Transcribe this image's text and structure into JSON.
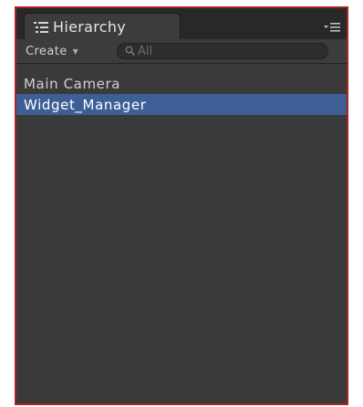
{
  "panel": {
    "title": "Hierarchy",
    "title_icon": "list-icon",
    "menu_icon": "panel-menu-icon"
  },
  "toolbar": {
    "create_label": "Create",
    "create_caret": "▼",
    "search_placeholder": "All",
    "search_value": ""
  },
  "hierarchy": {
    "items": [
      {
        "label": "Main Camera",
        "selected": false
      },
      {
        "label": "Widget_Manager",
        "selected": true
      }
    ]
  },
  "colors": {
    "panel_bg": "#3a3a3a",
    "selection": "#3e5f96",
    "frame_border": "#a8231e"
  }
}
